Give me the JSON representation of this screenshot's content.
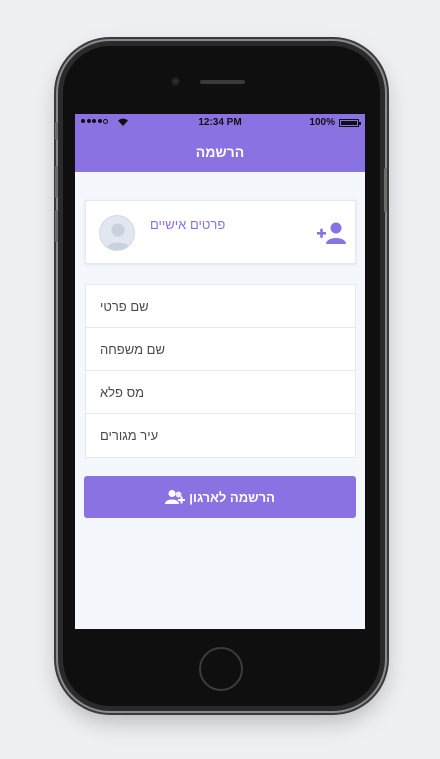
{
  "status_bar": {
    "time": "12:34 PM",
    "battery": "100%"
  },
  "nav": {
    "title": "הרשמה"
  },
  "profile_card": {
    "title": "פרטים אישיים",
    "avatar_icon": "user-avatar-icon",
    "action_icon": "add-user-icon"
  },
  "form": {
    "fields": [
      {
        "placeholder": "שם פרטי",
        "value": ""
      },
      {
        "placeholder": "שם משפחה",
        "value": ""
      },
      {
        "placeholder": "מס פלא",
        "value": ""
      },
      {
        "placeholder": "עיר מגורים",
        "value": ""
      }
    ]
  },
  "submit": {
    "label": "הרשמה לארגון",
    "icon": "group-add-icon"
  },
  "colors": {
    "accent": "#8a72e3",
    "background": "#eef0f4",
    "screen_bg": "#f4f7fc"
  }
}
